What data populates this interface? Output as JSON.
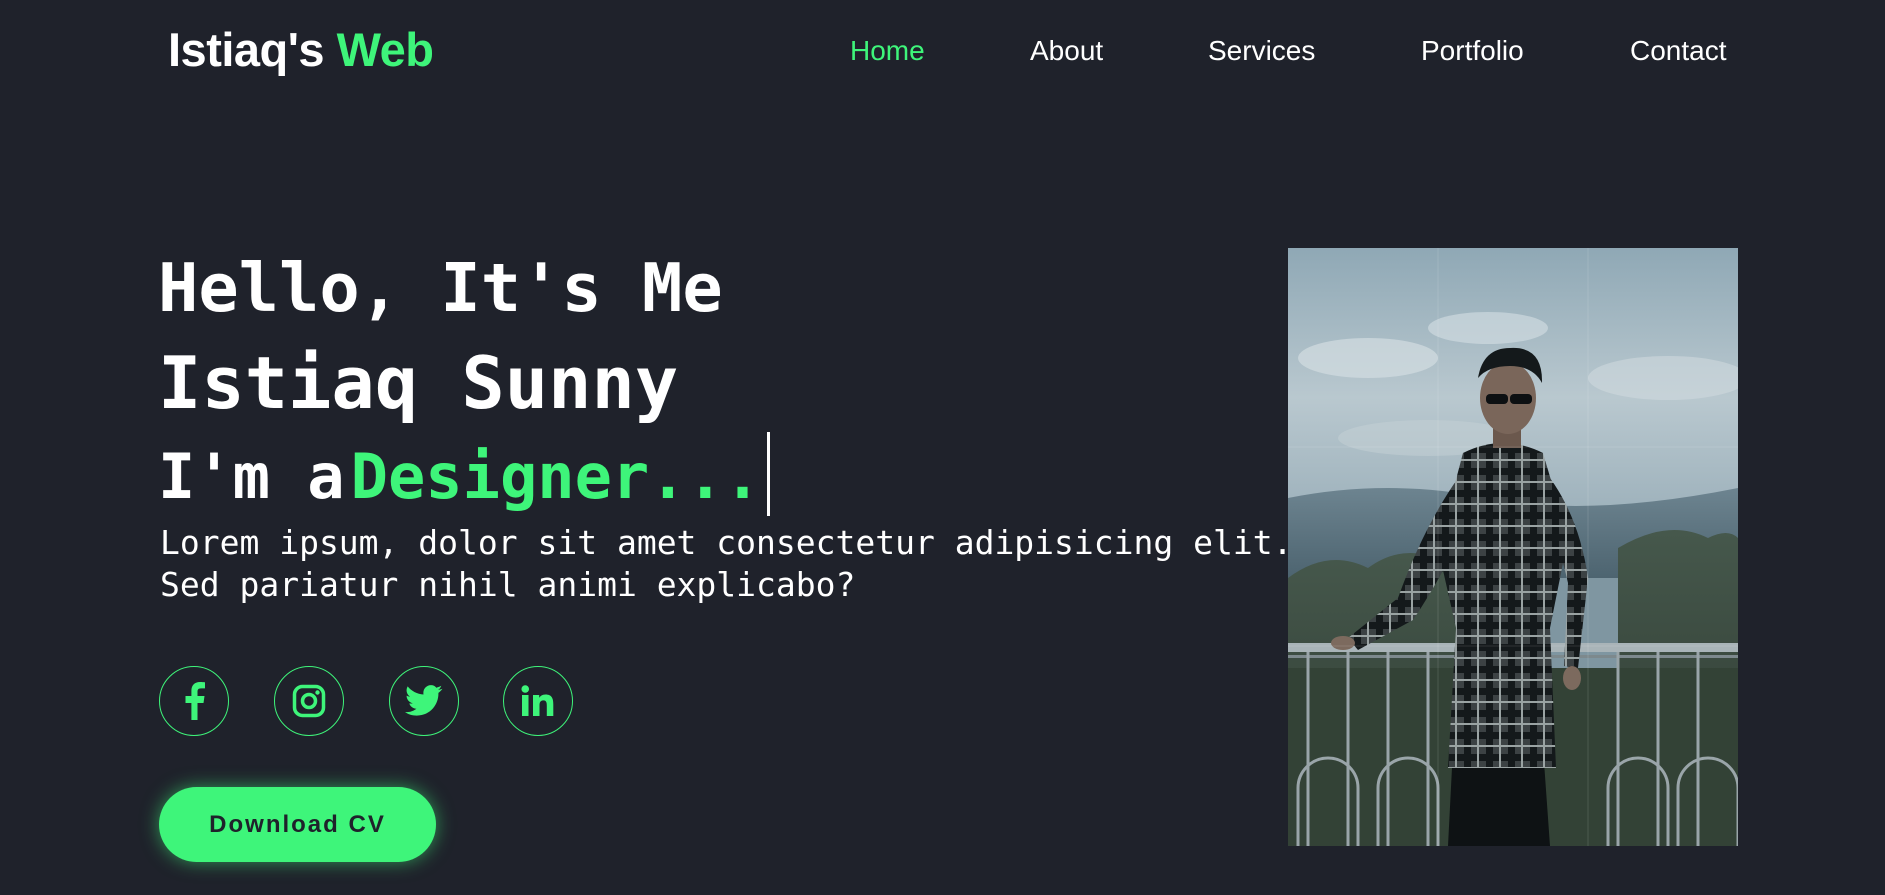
{
  "header": {
    "logo_main": "Istiaq's",
    "logo_accent": "Web",
    "nav": [
      "Home",
      "About",
      "Services",
      "Portfolio",
      "Contact"
    ],
    "active_nav": "Home"
  },
  "hero": {
    "line1": "Hello, It's Me",
    "line2": "Istiaq Sunny",
    "line3_prefix": "I'm a",
    "line3_role": "Designer...",
    "description": "Lorem ipsum, dolor sit amet consectetur adipisicing elit. Sed pariatur nihil animi explicabo?",
    "socials": [
      "facebook-icon",
      "instagram-icon",
      "twitter-icon",
      "linkedin-icon"
    ],
    "cv_button": "Download CV"
  },
  "colors": {
    "background": "#1f222b",
    "accent": "#3ef57a",
    "text": "#ffffff"
  }
}
